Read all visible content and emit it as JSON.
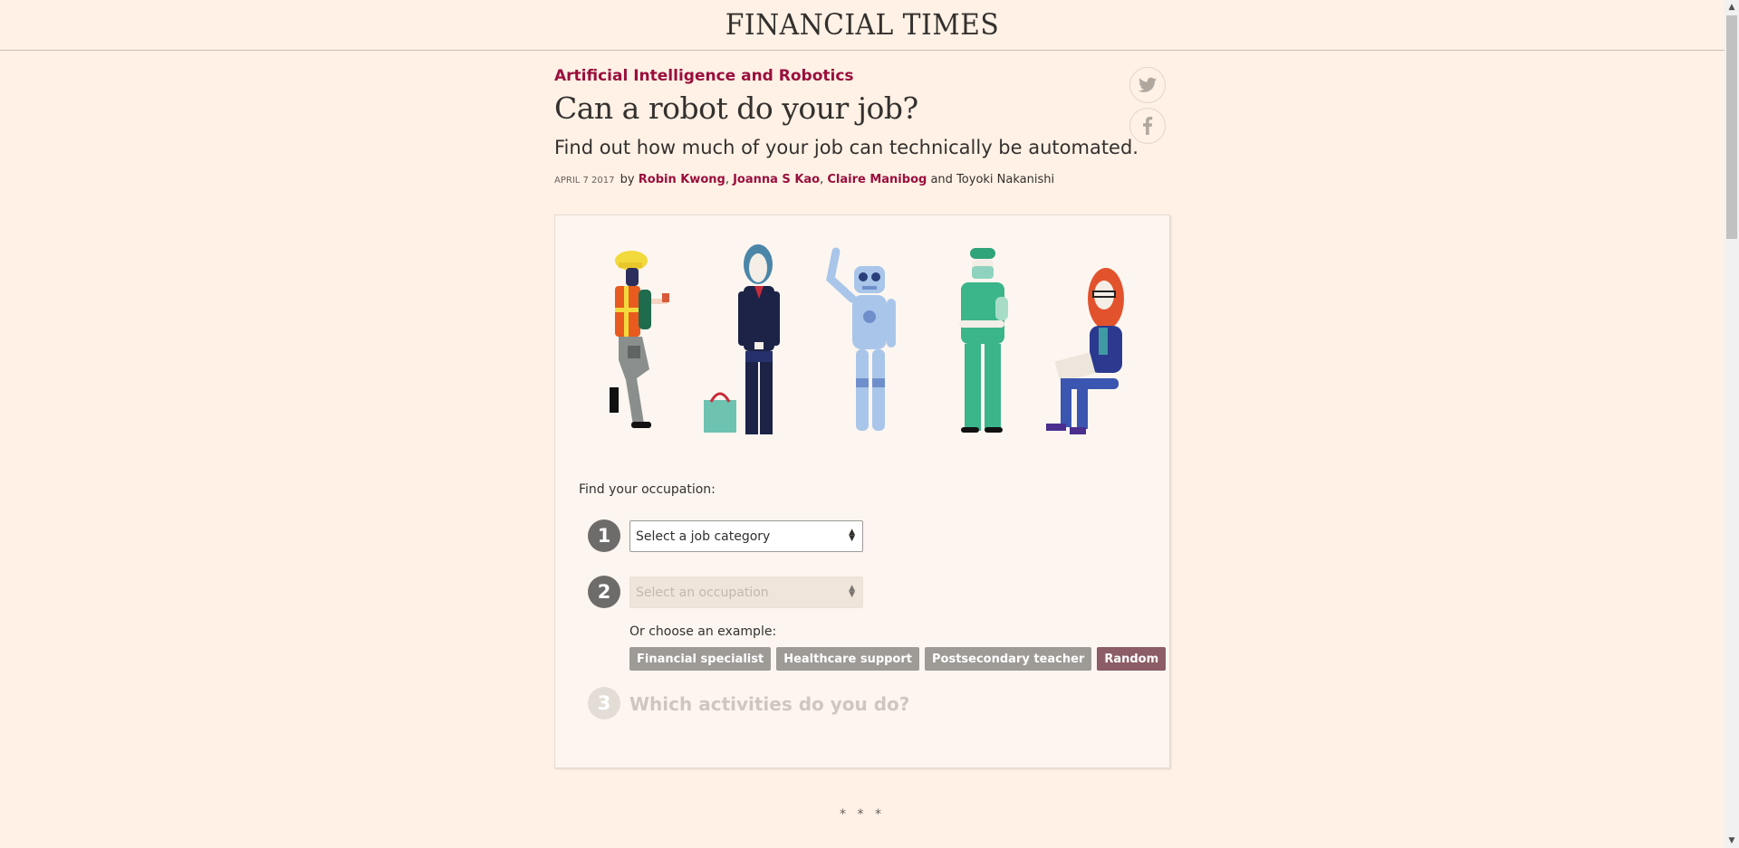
{
  "masthead": {
    "title": "FINANCIAL TIMES"
  },
  "article": {
    "topic": "Artificial Intelligence and Robotics",
    "headline": "Can a robot do your job?",
    "standfirst": "Find out how much of your job can technically be automated.",
    "date": "April 7 2017",
    "by": "by",
    "authors": [
      "Robin Kwong",
      "Joanna S Kao",
      "Claire Manibog"
    ],
    "and": "and",
    "last_author": "Toyoki Nakanishi"
  },
  "share": {
    "twitter_icon": "twitter-icon",
    "facebook_icon": "facebook-icon"
  },
  "quiz": {
    "find_label": "Find your occupation:",
    "step1": {
      "number": "1",
      "placeholder": "Select a job category"
    },
    "step2": {
      "number": "2",
      "placeholder": "Select an occupation"
    },
    "example_label": "Or choose an example:",
    "examples": [
      "Financial specialist",
      "Healthcare support",
      "Postsecondary teacher",
      "Random"
    ],
    "step3": {
      "number": "3",
      "title": "Which activities do you do?"
    }
  },
  "separator": "* * *",
  "colors": {
    "background": "#fff1e5",
    "claret": "#990f3d",
    "chip_grey": "#9e9a96",
    "chip_random": "#8c5d66"
  }
}
